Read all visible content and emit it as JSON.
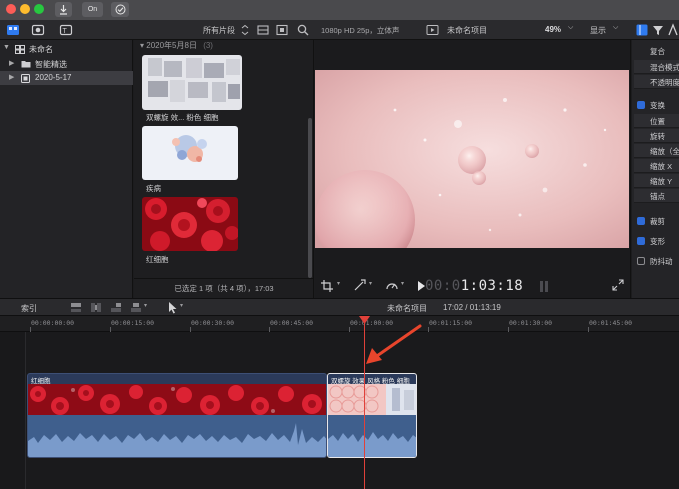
{
  "titlebar": {
    "buttons": [
      {
        "icon": "download-arrow-icon"
      },
      {
        "label": "On"
      },
      {
        "icon": "checkmark-circle-icon"
      }
    ]
  },
  "toolbar": {
    "filter_label": "所有片段",
    "format_info": "1080p HD 25p，立体声",
    "project_name": "未命名项目",
    "zoom": "49%",
    "display_menu": "显示"
  },
  "library": {
    "items": [
      {
        "label": "未命名",
        "expanded": true
      },
      {
        "label": "智能精选",
        "expanded": false
      },
      {
        "label": "2020-5-17",
        "selected": true
      }
    ]
  },
  "browser": {
    "group_header": "2020年5月8日",
    "group_count": "(3)",
    "clips": [
      {
        "label": "双螺旋 效... 粉色 细胞",
        "thumb": "blurred-gray"
      },
      {
        "label": "疾病",
        "thumb": "cells-illustration"
      },
      {
        "label": "红细胞",
        "thumb": "red-blood-cells"
      }
    ],
    "status": "已选定 1 项（共 4 项），17:03"
  },
  "viewer": {
    "timecode_dim": "00:0",
    "timecode": "1:03:18"
  },
  "inspector": {
    "rows": [
      {
        "label": "复合",
        "type": "header"
      },
      {
        "label": "混合模式",
        "type": "sub"
      },
      {
        "label": "不透明度",
        "type": "sub"
      },
      {
        "label": "变换",
        "type": "check",
        "checked": true
      },
      {
        "label": "位置",
        "type": "sub"
      },
      {
        "label": "旋转",
        "type": "sub"
      },
      {
        "label": "缩放（全部）",
        "type": "sub"
      },
      {
        "label": "缩放 X",
        "type": "sub"
      },
      {
        "label": "缩放 Y",
        "type": "sub"
      },
      {
        "label": "锚点",
        "type": "sub"
      },
      {
        "label": "裁剪",
        "type": "check",
        "checked": true
      },
      {
        "label": "变形",
        "type": "check",
        "checked": true
      },
      {
        "label": "防抖动",
        "type": "check",
        "checked": false
      }
    ]
  },
  "timeline_toolbar": {
    "index_label": "索引",
    "project_name": "未命名项目",
    "duration": "17:02 / 01:13:19"
  },
  "ruler": {
    "labels": [
      "00:00:00:00",
      "00:00:15:00",
      "00:00:30:00",
      "00:00:45:00",
      "00:01:00:00",
      "00:01:15:00",
      "00:01:30:00",
      "00:01:45:00"
    ]
  },
  "timeline": {
    "clips": [
      {
        "name": "红细胞",
        "kind": "red"
      },
      {
        "name": "双螺旋 效果 风格 粉色 细胞",
        "kind": "pink",
        "selected": true
      }
    ]
  },
  "colors": {
    "accent": "#2f6bd8",
    "playhead": "#e0413a",
    "audio_wave": "#3f5f8d",
    "annotation_arrow": "#e8452c"
  }
}
